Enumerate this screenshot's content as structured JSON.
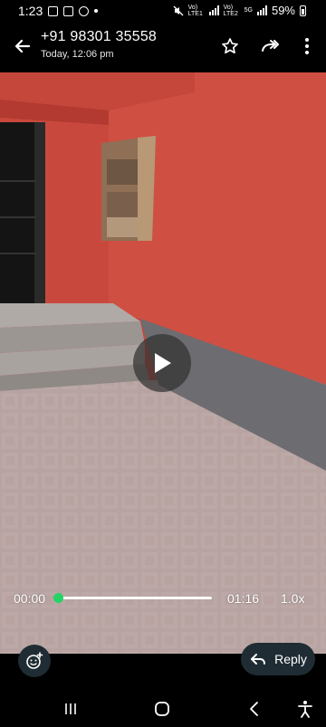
{
  "status_bar": {
    "time": "1:23",
    "battery": "59%",
    "sim1_label": "Vo) LTE1",
    "sim2_label": "Vo) LTE2",
    "network_5g": "5G"
  },
  "header": {
    "title": "+91 98301 35558",
    "subtitle": "Today, 12:06 pm",
    "icons": [
      "back-arrow-icon",
      "star-icon",
      "forward-icon",
      "more-vert-icon"
    ]
  },
  "player": {
    "current_time": "00:00",
    "duration": "01:16",
    "speed": "1.0x",
    "progress_fraction": 0.0,
    "accent_color": "#25d366"
  },
  "actions": {
    "reply_label": "Reply"
  },
  "nav": {
    "icons": [
      "recents-icon",
      "home-icon",
      "back-icon",
      "accessibility-icon"
    ]
  }
}
